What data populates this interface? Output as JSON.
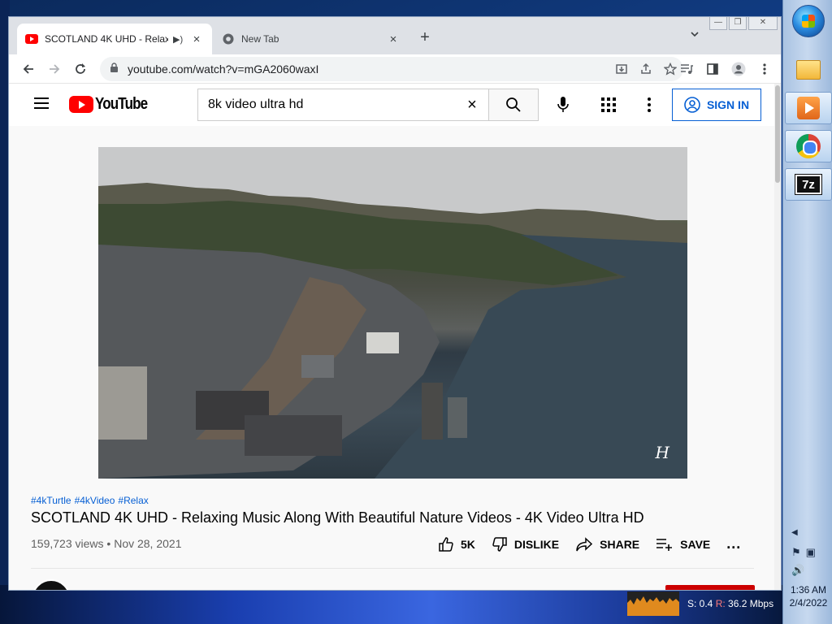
{
  "browser": {
    "tabs": [
      {
        "title": "SCOTLAND 4K UHD - Relaxin",
        "active": true
      },
      {
        "title": "New Tab",
        "active": false
      }
    ],
    "url": "youtube.com/watch?v=mGA2060waxI"
  },
  "youtube": {
    "logo_text": "YouTube",
    "search_query": "8k video ultra hd",
    "sign_in_label": "SIGN IN",
    "video": {
      "hashtags": [
        "#4kTurtle",
        "#4kVideo",
        "#Relax"
      ],
      "title": "SCOTLAND 4K UHD - Relaxing Music Along With Beautiful Nature Videos - 4K Video Ultra HD",
      "views": "159,723 views",
      "date": "Nov 28, 2021",
      "watermark": "H"
    },
    "actions": {
      "like_count": "5K",
      "dislike_label": "DISLIKE",
      "share_label": "SHARE",
      "save_label": "SAVE",
      "more_label": "..."
    }
  },
  "taskbar": {
    "clock_time": "1:36 AM",
    "clock_date": "2/4/2022",
    "sevenzip_label": "7z"
  },
  "net_meter": {
    "send_label": "S: 0.4",
    "recv_label": "R:",
    "recv_value": "36.2 Mbps"
  },
  "colors": {
    "youtube_red": "#ff0000",
    "link_blue": "#065fd4"
  }
}
